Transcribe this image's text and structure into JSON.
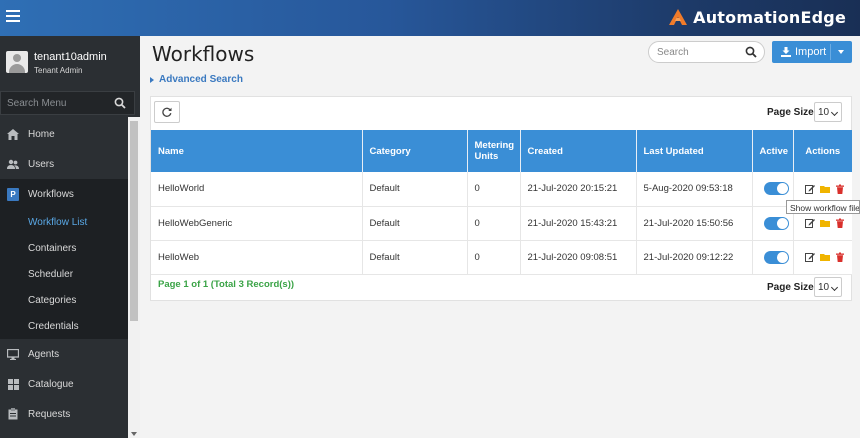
{
  "brand": {
    "name": "AutomationEdge",
    "accent": "#f07b2a"
  },
  "user": {
    "name": "tenant10admin",
    "role": "Tenant Admin"
  },
  "sidebar": {
    "search_placeholder": "Search Menu",
    "items": [
      {
        "label": "Home",
        "icon": "home-icon"
      },
      {
        "label": "Users",
        "icon": "users-icon"
      },
      {
        "label": "Workflows",
        "icon": "workflow-icon",
        "icon_glyph": "P",
        "active": true
      },
      {
        "label": "Agents",
        "icon": "monitor-icon"
      },
      {
        "label": "Catalogue",
        "icon": "grid-icon"
      },
      {
        "label": "Requests",
        "icon": "clipboard-icon"
      }
    ],
    "workflow_sub": [
      {
        "label": "Workflow List",
        "current": true
      },
      {
        "label": "Containers"
      },
      {
        "label": "Scheduler"
      },
      {
        "label": "Categories"
      },
      {
        "label": "Credentials"
      }
    ]
  },
  "main": {
    "title": "Workflows",
    "search_placeholder": "Search",
    "import_label": "Import",
    "advanced_search": "Advanced Search",
    "page_size_label": "Page Size",
    "page_size_value": "10",
    "pager_text": "Page 1 of 1 (Total 3 Record(s))",
    "tooltip": "Show workflow files"
  },
  "table": {
    "columns": [
      "Name",
      "Category",
      "Metering Units",
      "Created",
      "Last Updated",
      "Active",
      "Actions"
    ],
    "rows": [
      {
        "name": "HelloWorld",
        "category": "Default",
        "units": "0",
        "created": "21-Jul-2020 20:15:21",
        "updated": "5-Aug-2020 09:53:18",
        "active": true
      },
      {
        "name": "HelloWebGeneric",
        "category": "Default",
        "units": "0",
        "created": "21-Jul-2020 15:43:21",
        "updated": "21-Jul-2020 15:50:56",
        "active": true
      },
      {
        "name": "HelloWeb",
        "category": "Default",
        "units": "0",
        "created": "21-Jul-2020 09:08:51",
        "updated": "21-Jul-2020 09:12:22",
        "active": true
      }
    ]
  },
  "colors": {
    "primary": "#3a8ed6",
    "success": "#3aa346",
    "danger": "#d9302c",
    "folder": "#f0b400",
    "sidebar_bg": "#2b2f33"
  }
}
